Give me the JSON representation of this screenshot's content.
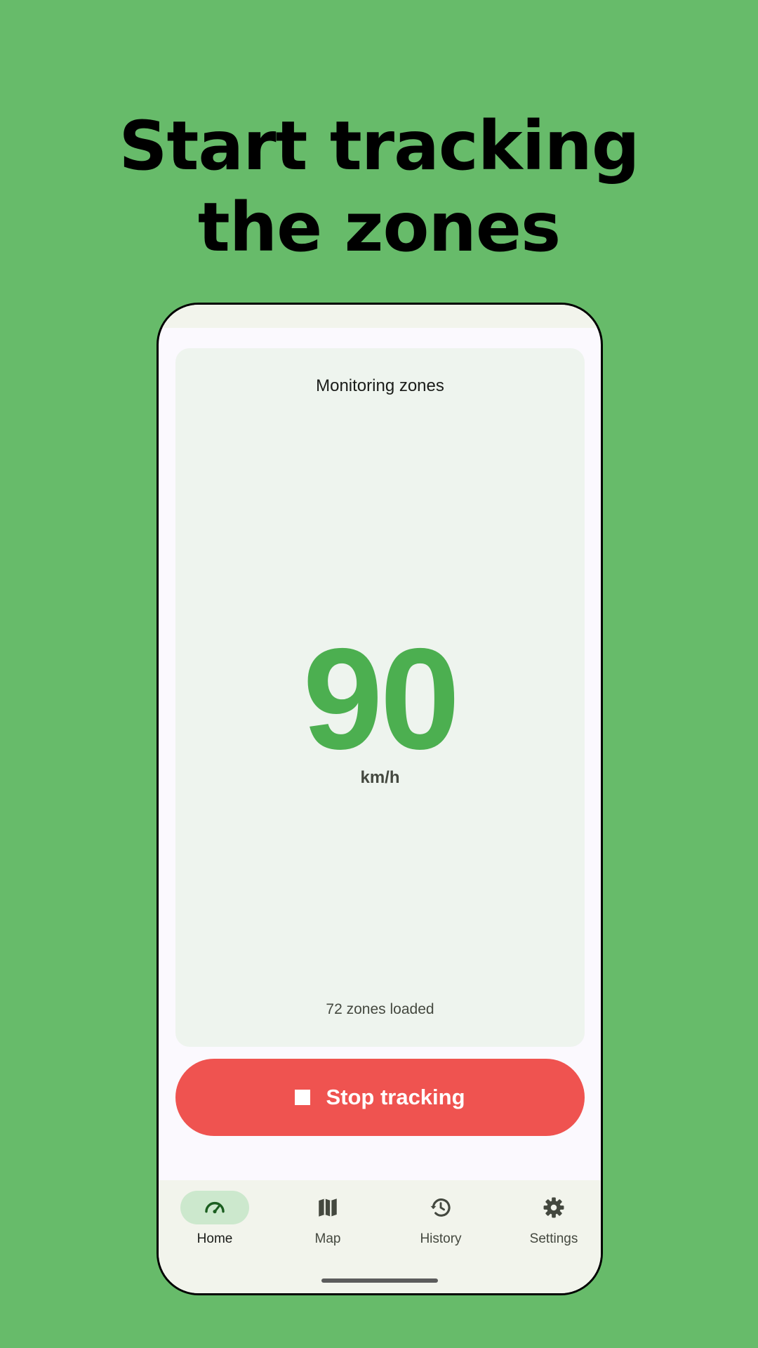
{
  "headline": {
    "line1": "Start tracking",
    "line2": "the zones"
  },
  "card": {
    "title": "Monitoring zones",
    "speed": "90",
    "unit": "km/h",
    "zones_status": "72 zones loaded"
  },
  "stop_button": {
    "label": "Stop tracking",
    "icon": "stop-icon",
    "color": "#ef5350"
  },
  "nav": {
    "items": [
      {
        "label": "Home",
        "icon": "speedometer-icon",
        "active": true
      },
      {
        "label": "Map",
        "icon": "map-icon",
        "active": false
      },
      {
        "label": "History",
        "icon": "history-icon",
        "active": false
      },
      {
        "label": "Settings",
        "icon": "gear-icon",
        "active": false
      }
    ]
  },
  "colors": {
    "background": "#67bb6a",
    "speed": "#4caf50",
    "nav_active": "#cce8cd"
  }
}
